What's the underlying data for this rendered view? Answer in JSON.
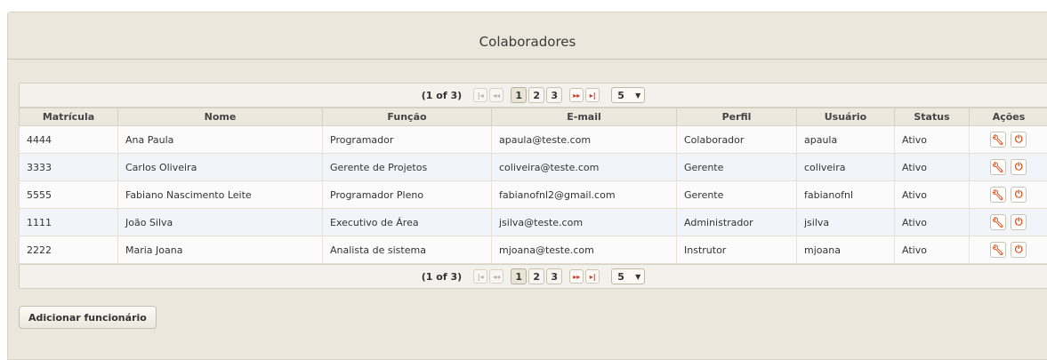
{
  "panel": {
    "title": "Colaboradores"
  },
  "pager": {
    "current": "(1 of 3)",
    "first": "◂◂",
    "prev": "◂◂",
    "next": "▸▸",
    "last": "▸▸",
    "pages": [
      "1",
      "2",
      "3"
    ],
    "rows_per_page": "5",
    "caret": "▼"
  },
  "table": {
    "columns": [
      "Matrícula",
      "Nome",
      "Função",
      "E-mail",
      "Perfil",
      "Usuário",
      "Status",
      "Ações"
    ],
    "rows": [
      [
        "4444",
        "Ana Paula",
        "Programador",
        "apaula@teste.com",
        "Colaborador",
        "apaula",
        "Ativo"
      ],
      [
        "3333",
        "Carlos Oliveira",
        "Gerente de Projetos",
        "coliveira@teste.com",
        "Gerente",
        "coliveira",
        "Ativo"
      ],
      [
        "5555",
        "Fabiano Nascimento Leite",
        "Programador Pleno",
        "fabianofnl2@gmail.com",
        "Gerente",
        "fabianofnl",
        "Ativo"
      ],
      [
        "1111",
        "João Silva",
        "Executivo de Área",
        "jsilva@teste.com",
        "Administrador",
        "jsilva",
        "Ativo"
      ],
      [
        "2222",
        "Maria Joana",
        "Analista de sistema",
        "mjoana@teste.com",
        "Instrutor",
        "mjoana",
        "Ativo"
      ]
    ],
    "action_icons": [
      "wrench-icon",
      "power-icon"
    ]
  },
  "add_button": {
    "label": "Adicionar funcionário"
  },
  "colors": {
    "accent": "#e04b10",
    "panel_bg": "#ebe7dd",
    "alt_row": "#f1f4f9"
  }
}
